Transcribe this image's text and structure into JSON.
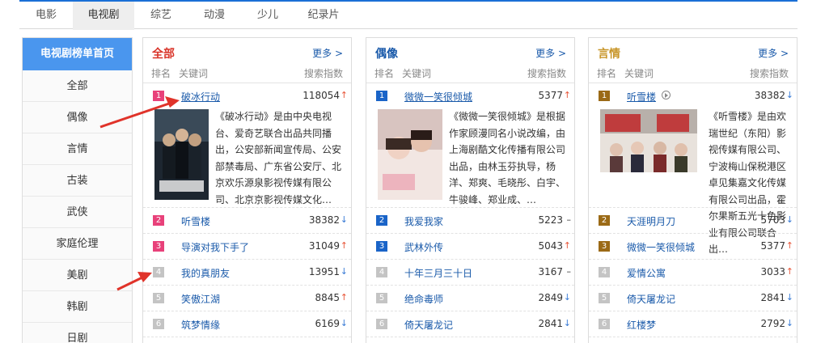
{
  "nav": {
    "tabs": [
      {
        "label": "电影",
        "active": false
      },
      {
        "label": "电视剧",
        "active": true
      },
      {
        "label": "综艺",
        "active": false
      },
      {
        "label": "动漫",
        "active": false
      },
      {
        "label": "少儿",
        "active": false
      },
      {
        "label": "纪录片",
        "active": false
      }
    ]
  },
  "sidebar": {
    "title": "电视剧榜单首页",
    "items": [
      {
        "label": "全部"
      },
      {
        "label": "偶像"
      },
      {
        "label": "言情"
      },
      {
        "label": "古装"
      },
      {
        "label": "武侠"
      },
      {
        "label": "家庭伦理"
      },
      {
        "label": "美剧"
      },
      {
        "label": "韩剧"
      },
      {
        "label": "日剧"
      }
    ]
  },
  "colors": {
    "accent_blue": "#4a96ee",
    "nav_border": "#1a6fd6",
    "link": "#1a5aaa",
    "up": "#e8573a",
    "down": "#3a7bd5",
    "annotation": "#e0332a"
  },
  "panels": [
    {
      "title": "全部",
      "title_color": "#d9352a",
      "more": "更多 >",
      "col_rank": "排名",
      "col_keyword": "关键词",
      "col_index": "搜索指数",
      "badge_colors": [
        "#e8417a",
        "#e8417a",
        "#e8417a",
        "#c4c4c4",
        "#c4c4c4",
        "#c4c4c4"
      ],
      "poster_icon": "poster-po-bing-xing-dong",
      "desc": "《破冰行动》是由中央电视台、爱奇艺联合出品共同播出，公安部新闻宣传局、公安部禁毒局、广东省公安厅、北京欢乐源泉影视传媒有限公司、北京京影视传媒文化…",
      "rows": [
        {
          "rank": "1",
          "name": "破冰行动",
          "value": "118054",
          "trend": "up",
          "trend_icon": "up-arrow-icon"
        },
        {
          "rank": "2",
          "name": "听雪楼",
          "value": "38382",
          "trend": "down",
          "trend_icon": "down-arrow-icon"
        },
        {
          "rank": "3",
          "name": "导演对我下手了",
          "value": "31049",
          "trend": "up",
          "trend_icon": "up-arrow-icon"
        },
        {
          "rank": "4",
          "name": "我的真朋友",
          "value": "13951",
          "trend": "down",
          "trend_icon": "down-arrow-icon"
        },
        {
          "rank": "5",
          "name": "笑傲江湖",
          "value": "8845",
          "trend": "up",
          "trend_icon": "up-arrow-icon"
        },
        {
          "rank": "6",
          "name": "筑梦情缘",
          "value": "6169",
          "trend": "down",
          "trend_icon": "down-arrow-icon"
        }
      ]
    },
    {
      "title": "偶像",
      "title_color": "#1a5aaa",
      "more": "更多 >",
      "col_rank": "排名",
      "col_keyword": "关键词",
      "col_index": "搜索指数",
      "badge_colors": [
        "#1a64c8",
        "#1a64c8",
        "#1a64c8",
        "#c4c4c4",
        "#c4c4c4",
        "#c4c4c4"
      ],
      "poster_icon": "poster-wei-wei-yi-xiao",
      "desc": "《微微一笑很倾城》是根据作家顾漫同名小说改编，由上海剧酷文化传播有限公司出品，由林玉芬执导，杨洋、郑爽、毛晓彤、白宇、牛骏峰、郑业成、…",
      "rows": [
        {
          "rank": "1",
          "name": "微微一笑很倾城",
          "value": "5377",
          "trend": "up",
          "trend_icon": "up-arrow-icon"
        },
        {
          "rank": "2",
          "name": "我爱我家",
          "value": "5223",
          "trend": "flat",
          "trend_icon": "flat-dash-icon"
        },
        {
          "rank": "3",
          "name": "武林外传",
          "value": "5043",
          "trend": "up",
          "trend_icon": "up-arrow-icon"
        },
        {
          "rank": "4",
          "name": "十年三月三十日",
          "value": "3167",
          "trend": "flat",
          "trend_icon": "flat-dash-icon"
        },
        {
          "rank": "5",
          "name": "绝命毒师",
          "value": "2849",
          "trend": "down",
          "trend_icon": "down-arrow-icon"
        },
        {
          "rank": "6",
          "name": "倚天屠龙记",
          "value": "2841",
          "trend": "down",
          "trend_icon": "down-arrow-icon"
        }
      ]
    },
    {
      "title": "言情",
      "title_color": "#c8962a",
      "more": "更多 >",
      "col_rank": "排名",
      "col_keyword": "关键词",
      "col_index": "搜索指数",
      "badge_colors": [
        "#9b6a16",
        "#9b6a16",
        "#9b6a16",
        "#c4c4c4",
        "#c4c4c4",
        "#c4c4c4"
      ],
      "poster_icon": "poster-ting-xue-lou",
      "desc": "《听雪楼》是由欢瑞世纪（东阳）影视传媒有限公司、宁波梅山保税港区卓见集嘉文化传媒有限公司出品，霍尔果斯五光十色影业有限公司联合出…",
      "rows": [
        {
          "rank": "1",
          "name": "听雪楼",
          "value": "38382",
          "trend": "down",
          "trend_icon": "down-arrow-icon",
          "play": true
        },
        {
          "rank": "2",
          "name": "天涯明月刀",
          "value": "5703",
          "trend": "down",
          "trend_icon": "down-arrow-icon"
        },
        {
          "rank": "3",
          "name": "微微一笑很倾城",
          "value": "5377",
          "trend": "up",
          "trend_icon": "up-arrow-icon"
        },
        {
          "rank": "4",
          "name": "爱情公寓",
          "value": "3033",
          "trend": "up",
          "trend_icon": "up-arrow-icon"
        },
        {
          "rank": "5",
          "name": "倚天屠龙记",
          "value": "2841",
          "trend": "down",
          "trend_icon": "down-arrow-icon"
        },
        {
          "rank": "6",
          "name": "红楼梦",
          "value": "2792",
          "trend": "down",
          "trend_icon": "down-arrow-icon"
        }
      ]
    }
  ]
}
